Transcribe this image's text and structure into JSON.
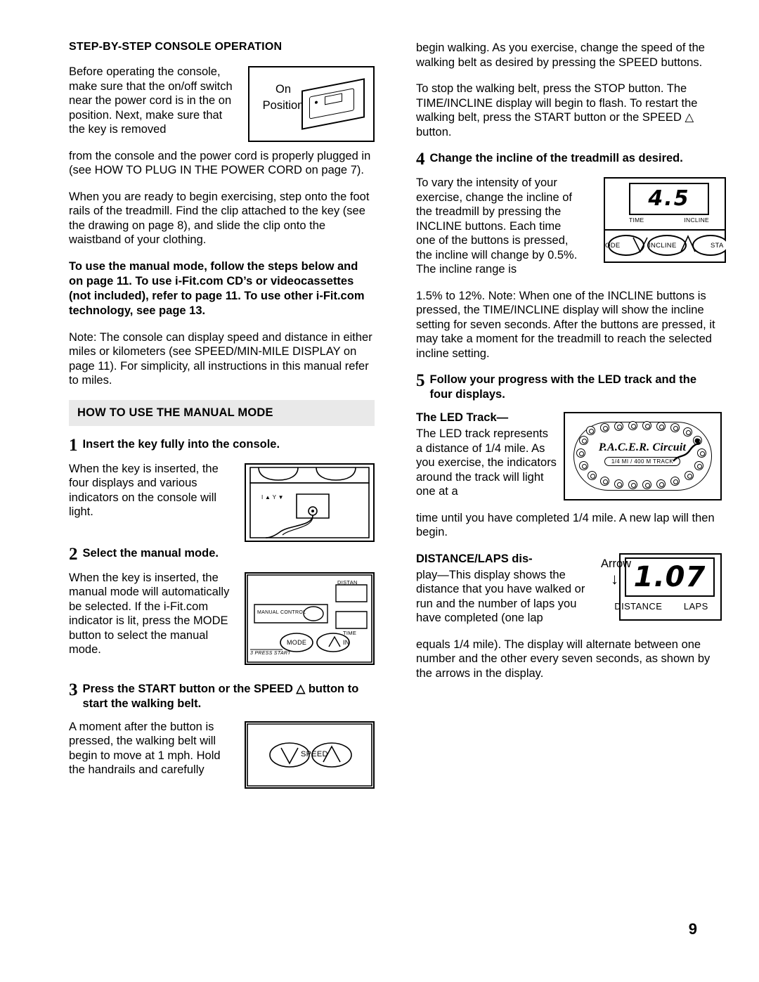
{
  "page": {
    "number": "9"
  },
  "left": {
    "heading": "STEP-BY-STEP CONSOLE OPERATION",
    "p1_wrap": "Before operating the console, make sure that the on/off switch near the power cord is in the on position. Next, make sure that the key is removed",
    "p1_rest": "from the console and the power cord is properly plugged in (see HOW TO PLUG IN THE POWER CORD on page 7).",
    "p2": "When you are ready to begin exercising, step onto the foot rails of the treadmill. Find the clip attached to the key (see the drawing on page 8), and slide the clip onto the waistband of your clothing.",
    "p3_bold": "To use the manual mode, follow the steps below and on page 11. To use i-Fit.com CD’s or videocassettes (not included), refer to page 11. To use other i-Fit.com technology, see page 13.",
    "p4": "Note: The console can display speed and distance in either miles or kilometers (see SPEED/MIN-MILE DISPLAY on page 11). For simplicity, all instructions in this manual refer to miles.",
    "band": "HOW TO USE THE MANUAL MODE",
    "step1": {
      "num": "1",
      "title": "Insert the key fully into the console.",
      "body": "When the key is inserted, the four displays and various indicators on the console will light."
    },
    "step2": {
      "num": "2",
      "title": "Select the manual mode.",
      "body": "When the key is inserted, the manual mode will automatically be selected. If the i-Fit.com indicator is lit, press the MODE button to select the manual mode."
    },
    "step3": {
      "num": "3",
      "title": "Press the START button or the SPEED △ button to start the walking belt.",
      "body": "A moment after the button is pressed, the walking belt will begin to move at 1 mph. Hold the handrails and carefully"
    },
    "fig_switch": {
      "label_line1": "On",
      "label_line2": "Position"
    },
    "fig_key": {
      "tiny_marks": "I ▲   Y ▼"
    },
    "fig_manual": {
      "manual_control": "MANUAL CONTROL",
      "distance": "DISTAN",
      "time": "TIME",
      "mode": "MODE",
      "incline": "IN",
      "press_start": "3 PRESS START"
    },
    "fig_speed": {
      "speed": "SPEED"
    }
  },
  "right": {
    "p1": "begin walking. As you exercise, change the speed of the walking belt as desired by pressing the SPEED buttons.",
    "p2": "To stop the walking belt, press the STOP button. The TIME/INCLINE display will begin to flash. To restart the walking belt, press the START button or the SPEED △ button.",
    "step4": {
      "num": "4",
      "title": "Change the incline of the treadmill as desired.",
      "body_wrap": "To vary the intensity of your exercise, change the incline of the treadmill by pressing the INCLINE buttons. Each time one of the buttons is pressed, the incline will change by 0.5%. The incline range is",
      "body_rest": "1.5% to 12%. Note: When one of the INCLINE buttons is pressed, the TIME/INCLINE display will show the incline setting for seven seconds. After the buttons are pressed, it may take a moment for the treadmill to reach the selected incline setting."
    },
    "step5": {
      "num": "5",
      "title": "Follow your progress with the LED track and the four displays.",
      "led_head": "The LED Track—",
      "led_wrap": "The LED track represents a distance of 1/4 mile. As you exercise, the indicators around the track will light one at a",
      "led_rest": "time until you have completed 1/4 mile. A new lap will then begin.",
      "dist_head": "DISTANCE/LAPS dis-",
      "dist_wrap": "play—This display shows the distance that you have walked or run and the number of laps you have completed (one lap",
      "dist_rest": "equals 1/4 mile). The display will alternate between one number and the other every seven seconds, as shown by the arrows in the display."
    },
    "fig_incline": {
      "value": "4.5",
      "label_time": "TIME",
      "label_incline": "INCLINE",
      "btn_mode": "ODE",
      "btn_incline": "INCLINE",
      "btn_start": "STA"
    },
    "fig_track": {
      "brand": "P.A.C.E.R. Circuit",
      "sub": "1/4 MI / 400 M TRACK"
    },
    "fig_dist": {
      "arrow_label": "Arrow",
      "arrow_glyph": "↓",
      "value": "1.07",
      "label_distance": "DISTANCE",
      "label_laps": "LAPS"
    }
  }
}
